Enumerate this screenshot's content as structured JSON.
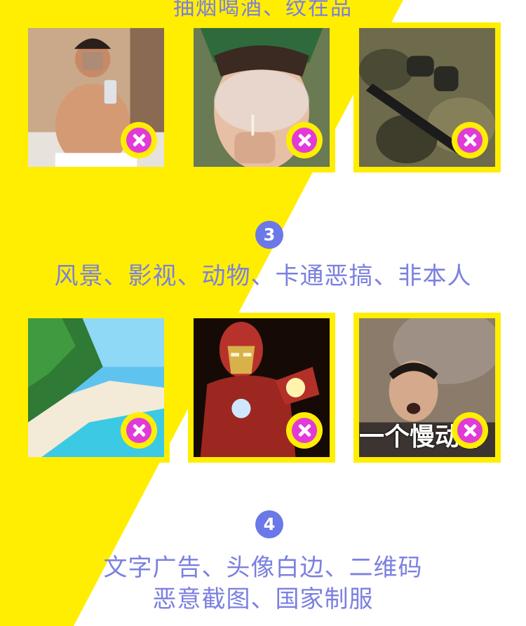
{
  "top_label_partial": "抽烟喝酒、纹在品",
  "section3": {
    "number": "3",
    "label": "风景、影视、动物、卡通恶搞、非本人"
  },
  "section4": {
    "number": "4",
    "label_line1": "文字广告、头像白边、二维码",
    "label_line2": "恶意截图、国家制服"
  },
  "meme_caption": "一个慢动作",
  "colors": {
    "accent_yellow": "#ffee00",
    "number_badge": "#6b78e8",
    "label_text": "#7b80df",
    "reject_mark": "#e23ad6"
  },
  "icons": {
    "reject": "close-circle-icon"
  }
}
